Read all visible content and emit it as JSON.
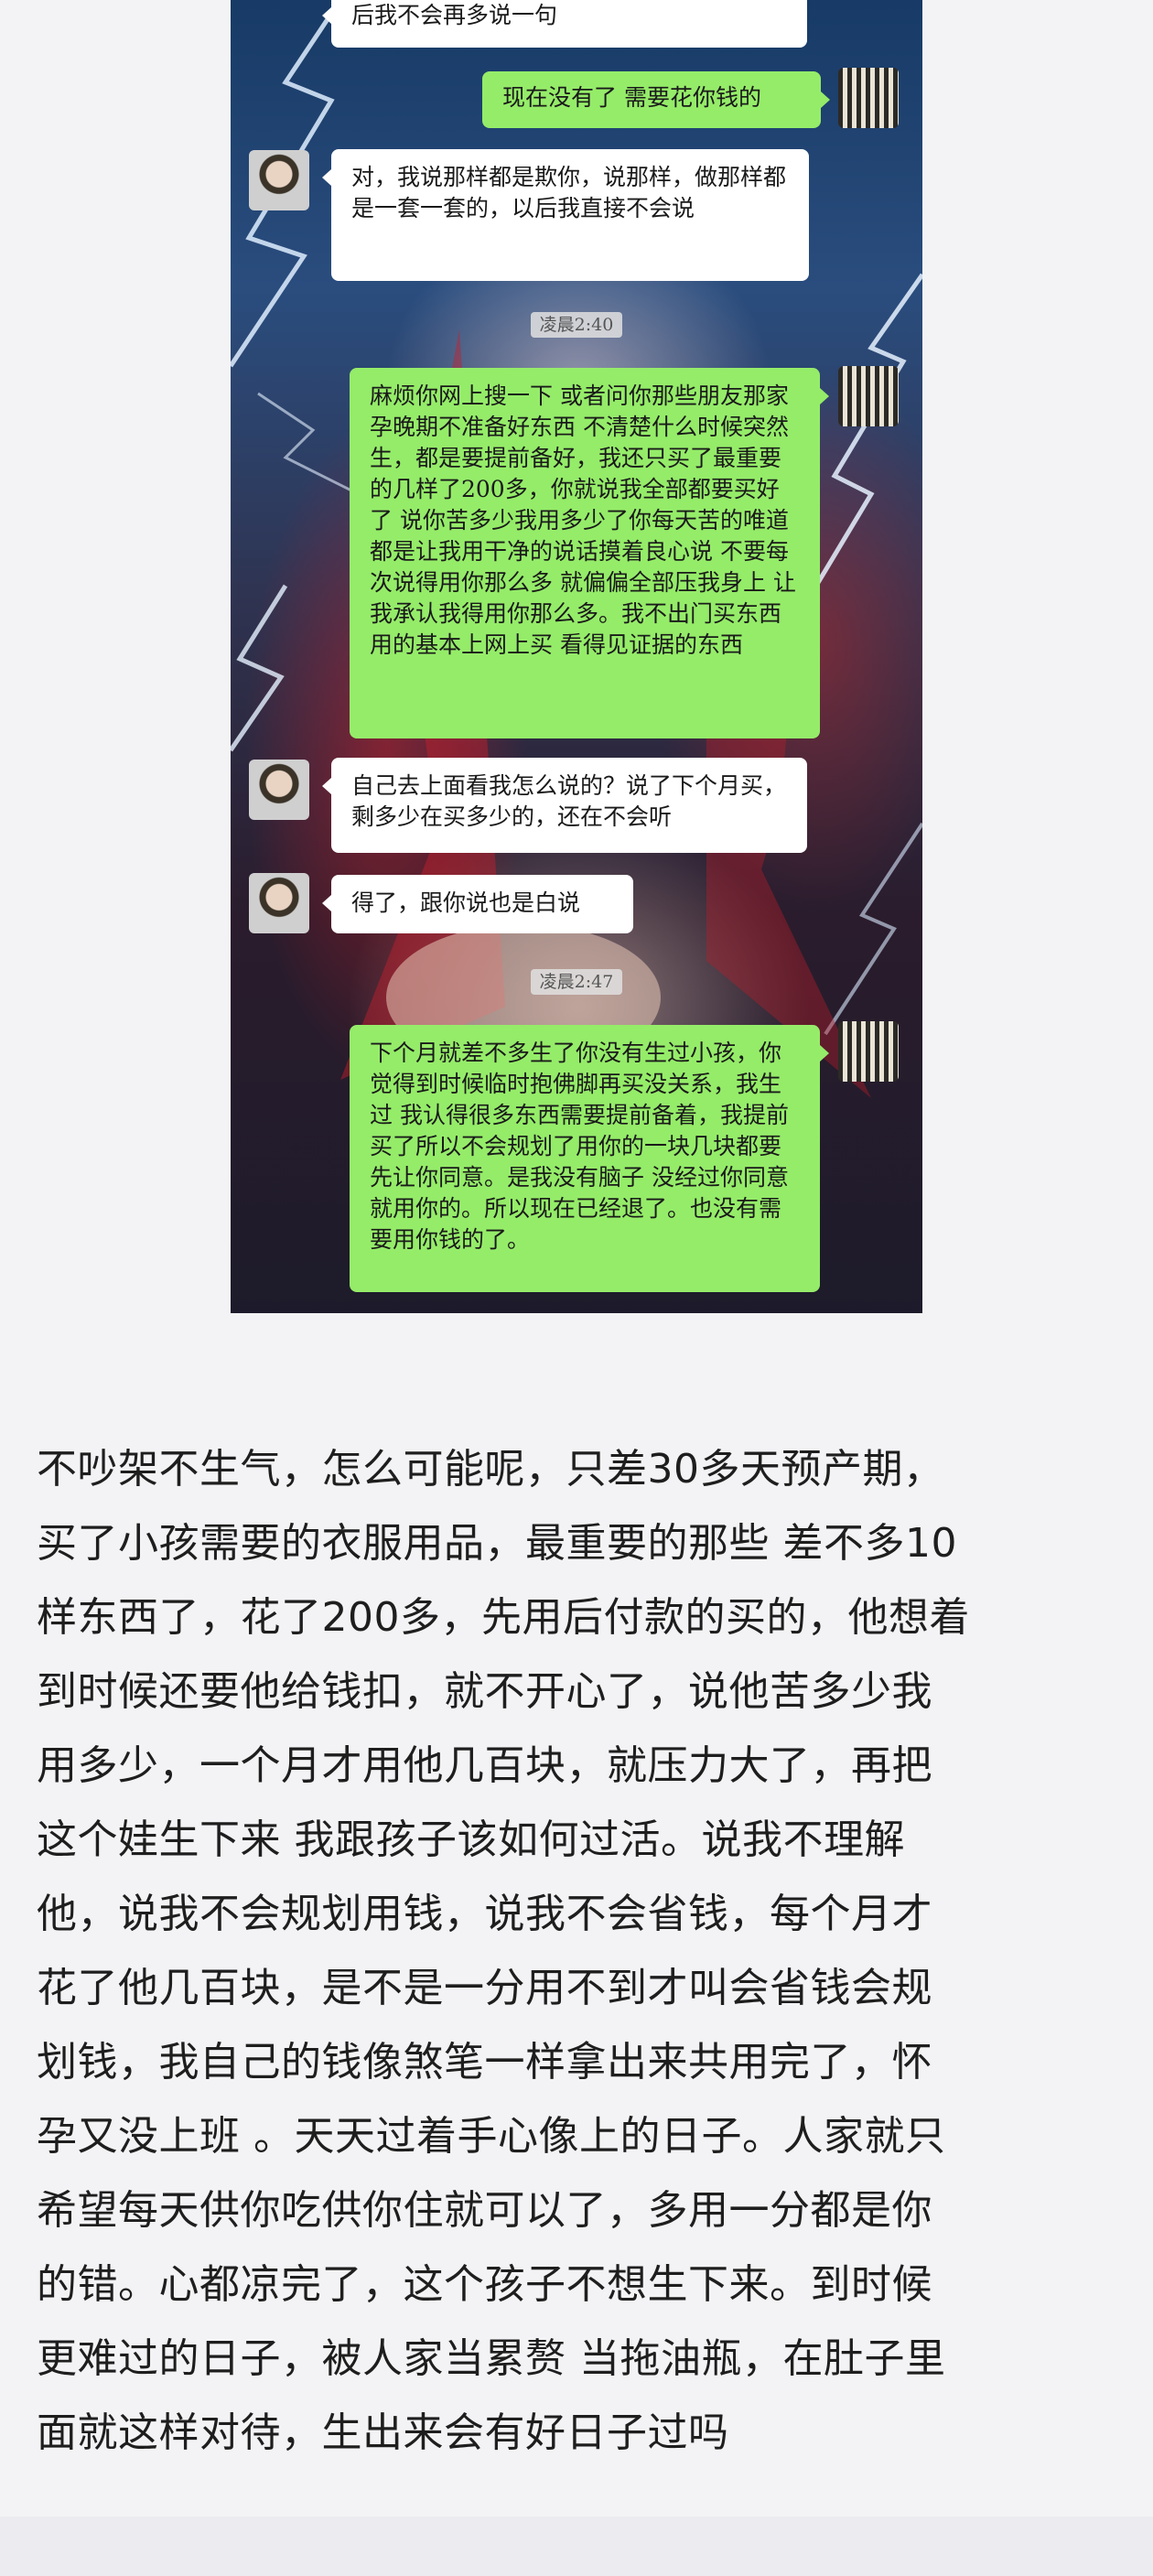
{
  "chat": {
    "messages": [
      {
        "id": "m0",
        "side": "in",
        "text": "后我不会再多说一句"
      },
      {
        "id": "m1",
        "side": "out",
        "text": "现在没有了 需要花你钱的"
      },
      {
        "id": "m2",
        "side": "in",
        "text": "对，我说那样都是欺你，说那样，做那样都是一套一套的，以后我直接不会说"
      },
      {
        "id": "m3",
        "side": "out",
        "text": "麻烦你网上搜一下 或者问你那些朋友那家孕晚期不准备好东西 不清楚什么时候突然生，都是要提前备好，我还只买了最重要的几样了200多，你就说我全部都要买好了 说你苦多少我用多少了你每天苦的唯道都是让我用干净的说话摸着良心说 不要每次说得用你那么多 就偏偏全部压我身上 让我承认我得用你那么多。我不出门买东西 用的基本上网上买 看得见证据的东西"
      },
      {
        "id": "m4",
        "side": "in",
        "text": "自己去上面看我怎么说的？说了下个月买，剩多少在买多少的，还在不会听"
      },
      {
        "id": "m5",
        "side": "in",
        "text": "得了，跟你说也是白说"
      },
      {
        "id": "m6",
        "side": "out",
        "text": "下个月就差不多生了你没有生过小孩，你觉得到时候临时抱佛脚再买没关系，我生过 我认得很多东西需要提前备着，我提前买了所以不会规划了用你的一块几块都要先让你同意。是我没有脑子 没经过你同意就用你的。所以现在已经退了。也没有需要用你钱的了。"
      }
    ],
    "timestamps": [
      "凌晨2:40",
      "凌晨2:47"
    ]
  },
  "input_bar": {
    "voice_icon": "voice-icon",
    "mic_icon": "microphone-icon",
    "emoji_icon": "emoji-icon",
    "add_icon": "add-icon"
  },
  "post": {
    "lines": [
      "不吵架不生气，怎么可能呢，只差30多天预产期，",
      "买了小孩需要的衣服用品，最重要的那些 差不多10",
      "样东西了，花了200多，先用后付款的买的，他想着",
      "到时候还要他给钱扣，就不开心了，说他苦多少我",
      "用多少，一个月才用他几百块，就压力大了，再把",
      "这个娃生下来 我跟孩子该如何过活。说我不理解",
      "他，说我不会规划用钱，说我不会省钱，每个月才",
      "花了他几百块，是不是一分用不到才叫会省钱会规",
      "划钱，我自己的钱像煞笔一样拿出来共用完了，怀",
      "孕又没上班 。天天过着手心像上的日子。人家就只",
      "希望每天供你吃供你住就可以了，多用一分都是你",
      "的错。心都凉完了，这个孩子不想生下来。到时候",
      "更难过的日子，被人家当累赘 当拖油瓶，在肚子里",
      "面就这样对待，生出来会有好日子过吗"
    ]
  },
  "colors": {
    "bubble_out": "#95ec69",
    "bubble_in": "#ffffff",
    "page_bg": "#f3f3f5"
  }
}
